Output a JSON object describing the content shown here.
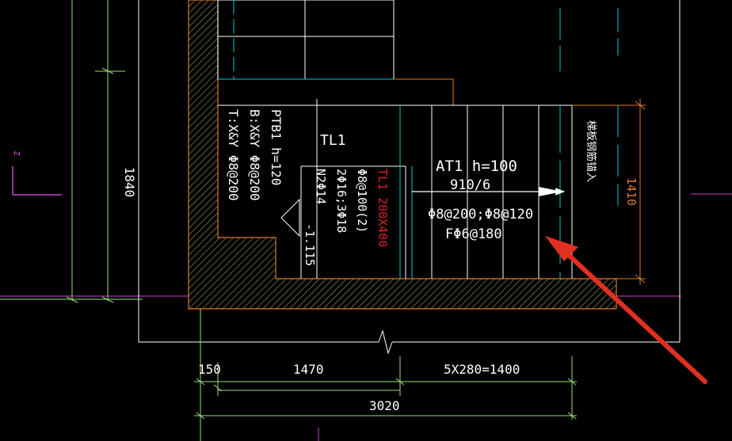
{
  "labels": {
    "dim_1840": "1840",
    "axis_mark": "z",
    "slab_name": "PTB1 h=120",
    "slab_bottom": "B:X&Y Φ8@200",
    "slab_top": "T:X&Y Φ8@200",
    "beam_id": "TL1",
    "beam_red": "TL1 200X400",
    "beam_stirrup": "Φ8@100(2)",
    "beam_bars": "2Φ16;3Φ18",
    "beam_side": "N2Φ14",
    "level": "-1.115",
    "stair_name": "AT1 h=100",
    "stair_steps": "910/6",
    "stair_main": "Φ8@200;Φ8@120",
    "stair_dist": "FΦ6@180",
    "vertical_note": "梯板钢筋锚入",
    "dim_1410": "1410",
    "dim_150": "150",
    "dim_1470": "1470",
    "dim_steps": "5X280=1400",
    "dim_3020": "3020"
  },
  "colors": {
    "background": "#000000",
    "white": "#ffffff",
    "cyan": "#00c8d8",
    "green": "#9adf7a",
    "orange": "#e07a2a",
    "magenta": "#d040d0",
    "red": "#e02020",
    "hatch": "#7a6a40",
    "arrow": "#e03020"
  }
}
